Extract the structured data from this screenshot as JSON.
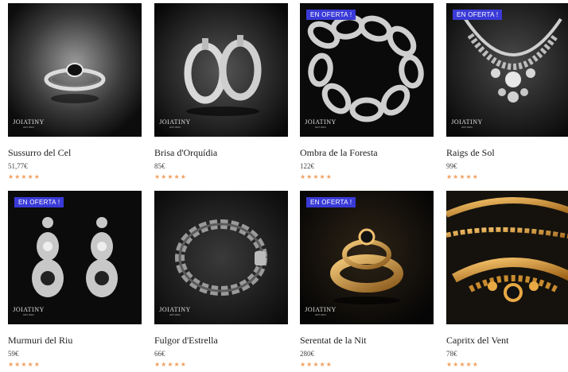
{
  "badge_label": "EN OFERTA !",
  "brand": {
    "name": "JOIATINY",
    "tagline": "EST 2024"
  },
  "rating_stars": "★★★★★",
  "accent_colors": {
    "badge": "#3a3ad8",
    "stars": "#f0a060"
  },
  "products": [
    {
      "name": "Sussurro del Cel",
      "price": "51,77€",
      "on_sale": false,
      "image": "silver-ring-with-black-stone"
    },
    {
      "name": "Brisa d'Orquídia",
      "price": "85€",
      "on_sale": false,
      "image": "silver-hoop-earrings"
    },
    {
      "name": "Ombra de la Foresta",
      "price": "122€",
      "on_sale": true,
      "image": "silver-chain-bracelet"
    },
    {
      "name": "Raigs de Sol",
      "price": "99€",
      "on_sale": true,
      "image": "silver-statement-necklace"
    },
    {
      "name": "Murmuri del Riu",
      "price": "59€",
      "on_sale": true,
      "image": "silver-drop-earrings"
    },
    {
      "name": "Fulgor d'Estrella",
      "price": "66€",
      "on_sale": false,
      "image": "dark-silver-chain-bracelet"
    },
    {
      "name": "Serentat de la Nit",
      "price": "280€",
      "on_sale": true,
      "image": "gold-ring-with-black-stone"
    },
    {
      "name": "Capritx del Vent",
      "price": "78€",
      "on_sale": false,
      "image": "gold-ornate-necklace"
    }
  ]
}
